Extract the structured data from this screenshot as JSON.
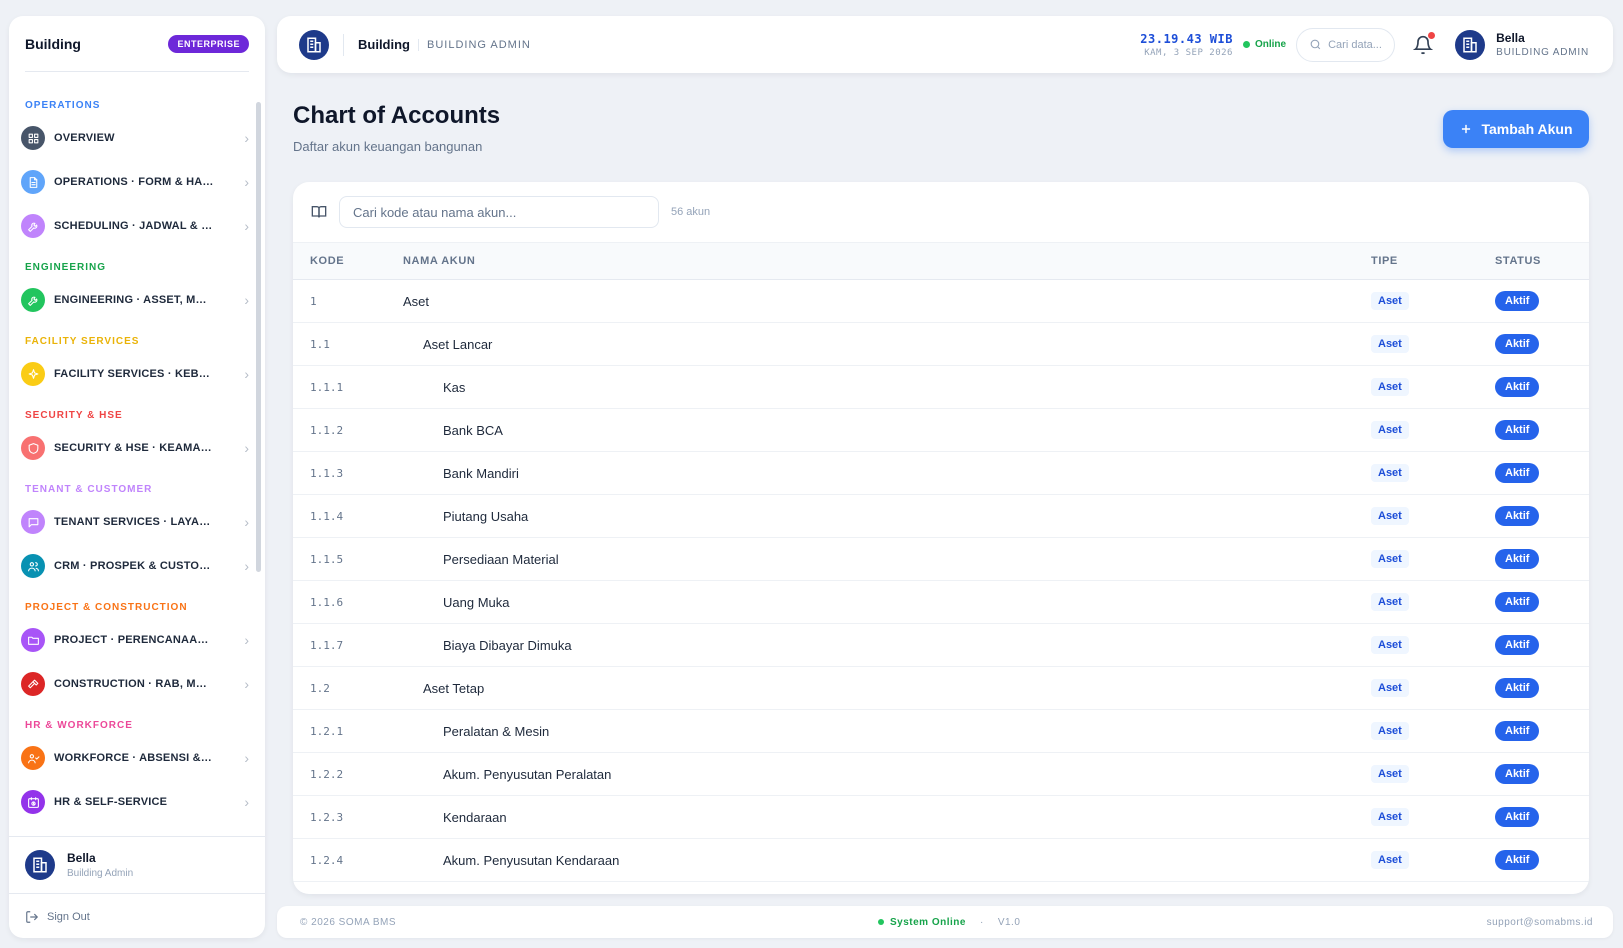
{
  "sidebar": {
    "brand": "Building",
    "badge": "ENTERPRISE",
    "sections": [
      {
        "label": "OPERATIONS",
        "color": "#3b82f6",
        "items": [
          {
            "label": "OVERVIEW",
            "icon": "grid-icon",
            "color": "#475569"
          },
          {
            "label": "OPERATIONS · FORM & HASIL CEKLIST",
            "icon": "document-icon",
            "color": "#60a5fa"
          },
          {
            "label": "SCHEDULING · JADWAL & PENUGASAN",
            "icon": "wrench-icon",
            "color": "#c084fc"
          }
        ]
      },
      {
        "label": "ENGINEERING",
        "color": "#16a34a",
        "items": [
          {
            "label": "ENGINEERING · ASSET, MAINTENANCE",
            "icon": "wrench-icon",
            "color": "#22c55e"
          }
        ]
      },
      {
        "label": "FACILITY SERVICES",
        "color": "#eab308",
        "items": [
          {
            "label": "FACILITY SERVICES · KEBERSIHAN",
            "icon": "sparkle-icon",
            "color": "#facc15"
          }
        ]
      },
      {
        "label": "SECURITY & HSE",
        "color": "#ef4444",
        "items": [
          {
            "label": "SECURITY & HSE · KEAMANAN",
            "icon": "shield-icon",
            "color": "#f87171"
          }
        ]
      },
      {
        "label": "TENANT & CUSTOMER",
        "color": "#c084fc",
        "items": [
          {
            "label": "TENANT SERVICES · LAYANAN TENANT",
            "icon": "chat-icon",
            "color": "#c084fc"
          },
          {
            "label": "CRM · PROSPEK & CUSTOMER",
            "icon": "users-icon",
            "color": "#0891b2"
          }
        ]
      },
      {
        "label": "PROJECT & CONSTRUCTION",
        "color": "#f97316",
        "items": [
          {
            "label": "PROJECT · PERENCANAAN PROYEK",
            "icon": "folder-icon",
            "color": "#a855f7"
          },
          {
            "label": "CONSTRUCTION · RAB, MATERIAL",
            "icon": "hammer-icon",
            "color": "#dc2626"
          }
        ]
      },
      {
        "label": "HR & WORKFORCE",
        "color": "#ec4899",
        "items": [
          {
            "label": "WORKFORCE · ABSENSI & SHIFT",
            "icon": "user-check-icon",
            "color": "#f97316"
          },
          {
            "label": "HR & SELF-SERVICE",
            "icon": "calendar-clock-icon",
            "color": "#9333ea"
          }
        ]
      }
    ],
    "user": {
      "name": "Bella",
      "role": "Building Admin"
    },
    "signout": "Sign Out"
  },
  "topbar": {
    "title": "Building",
    "subtitle": "BUILDING ADMIN",
    "time": "23.19.43 WIB",
    "date": "KAM, 3 SEP 2026",
    "status": "Online",
    "search_placeholder": "Cari data...",
    "user": {
      "name": "Bella",
      "role": "BUILDING ADMIN"
    }
  },
  "main": {
    "title": "Chart of Accounts",
    "subtitle": "Daftar akun keuangan bangunan",
    "add_button": "Tambah Akun",
    "search_placeholder": "Cari kode atau nama akun...",
    "count": "56 akun",
    "columns": {
      "code": "KODE",
      "name": "NAMA AKUN",
      "type": "TIPE",
      "status": "STATUS"
    },
    "rows": [
      {
        "code": "1",
        "name": "Aset",
        "level": 0,
        "type": "Aset",
        "status": "Aktif"
      },
      {
        "code": "1.1",
        "name": "Aset Lancar",
        "level": 1,
        "type": "Aset",
        "status": "Aktif"
      },
      {
        "code": "1.1.1",
        "name": "Kas",
        "level": 2,
        "type": "Aset",
        "status": "Aktif"
      },
      {
        "code": "1.1.2",
        "name": "Bank BCA",
        "level": 2,
        "type": "Aset",
        "status": "Aktif"
      },
      {
        "code": "1.1.3",
        "name": "Bank Mandiri",
        "level": 2,
        "type": "Aset",
        "status": "Aktif"
      },
      {
        "code": "1.1.4",
        "name": "Piutang Usaha",
        "level": 2,
        "type": "Aset",
        "status": "Aktif"
      },
      {
        "code": "1.1.5",
        "name": "Persediaan Material",
        "level": 2,
        "type": "Aset",
        "status": "Aktif"
      },
      {
        "code": "1.1.6",
        "name": "Uang Muka",
        "level": 2,
        "type": "Aset",
        "status": "Aktif"
      },
      {
        "code": "1.1.7",
        "name": "Biaya Dibayar Dimuka",
        "level": 2,
        "type": "Aset",
        "status": "Aktif"
      },
      {
        "code": "1.2",
        "name": "Aset Tetap",
        "level": 1,
        "type": "Aset",
        "status": "Aktif"
      },
      {
        "code": "1.2.1",
        "name": "Peralatan & Mesin",
        "level": 2,
        "type": "Aset",
        "status": "Aktif"
      },
      {
        "code": "1.2.2",
        "name": "Akum. Penyusutan Peralatan",
        "level": 2,
        "type": "Aset",
        "status": "Aktif"
      },
      {
        "code": "1.2.3",
        "name": "Kendaraan",
        "level": 2,
        "type": "Aset",
        "status": "Aktif"
      },
      {
        "code": "1.2.4",
        "name": "Akum. Penyusutan Kendaraan",
        "level": 2,
        "type": "Aset",
        "status": "Aktif"
      }
    ]
  },
  "footer": {
    "copyright": "© 2026 SOMA BMS",
    "status": "System Online",
    "separator": "·",
    "version": "V1.0",
    "email": "support@somabms.id"
  }
}
